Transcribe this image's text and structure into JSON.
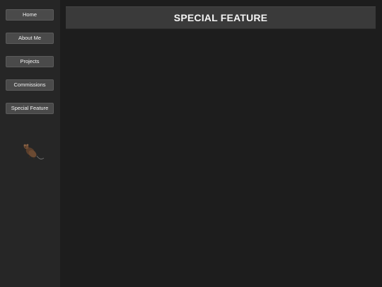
{
  "sidebar": {
    "items": [
      {
        "label": "Home"
      },
      {
        "label": "About Me"
      },
      {
        "label": "Projects"
      },
      {
        "label": "Commissions"
      },
      {
        "label": "Special Feature"
      }
    ],
    "mascot_icon": "rat-icon"
  },
  "main": {
    "title": "SPECIAL FEATURE"
  },
  "colors": {
    "background": "#1d1d1d",
    "sidebar": "#262626",
    "button": "#4a4a4a",
    "header": "#3a3a3a",
    "text": "#f4f4f4"
  }
}
